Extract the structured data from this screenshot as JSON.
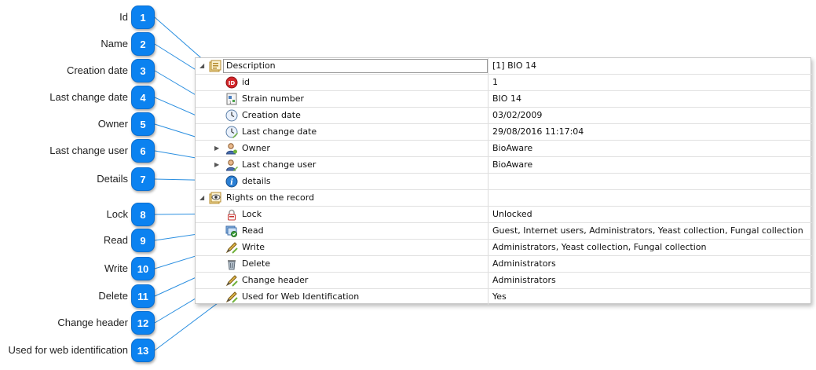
{
  "callouts": [
    {
      "num": "1",
      "label": "Id"
    },
    {
      "num": "2",
      "label": "Name"
    },
    {
      "num": "3",
      "label": "Creation date"
    },
    {
      "num": "4",
      "label": "Last change date"
    },
    {
      "num": "5",
      "label": "Owner"
    },
    {
      "num": "6",
      "label": "Last change user"
    },
    {
      "num": "7",
      "label": "Details"
    },
    {
      "num": "8",
      "label": "Lock"
    },
    {
      "num": "9",
      "label": "Read"
    },
    {
      "num": "10",
      "label": "Write"
    },
    {
      "num": "11",
      "label": "Delete"
    },
    {
      "num": "12",
      "label": "Change header"
    },
    {
      "num": "13",
      "label": "Used for web identification"
    }
  ],
  "groups": {
    "description": {
      "label": "Description",
      "value": "[1] BIO 14",
      "icon": "record-description-icon"
    },
    "rights": {
      "label": "Rights on the record",
      "value": "",
      "icon": "rights-eye-icon"
    }
  },
  "rows": [
    {
      "name": "id",
      "value": "1",
      "icon": "id-icon"
    },
    {
      "name": "Strain number",
      "value": "BIO 14",
      "icon": "strain-number-icon"
    },
    {
      "name": "Creation date",
      "value": "03/02/2009",
      "icon": "clock-icon"
    },
    {
      "name": "Last change date",
      "value": "29/08/2016 11:17:04",
      "icon": "clock-edit-icon"
    },
    {
      "name": "Owner",
      "value": "BioAware",
      "icon": "user-icon"
    },
    {
      "name": "Last change user",
      "value": "BioAware",
      "icon": "user-edit-icon"
    },
    {
      "name": "details",
      "value": "",
      "icon": "info-icon"
    },
    {
      "name": "Lock",
      "value": "Unlocked",
      "icon": "lock-icon"
    },
    {
      "name": "Read",
      "value": "Guest, Internet users, Administrators, Yeast collection, Fungal collection",
      "icon": "read-icon"
    },
    {
      "name": "Write",
      "value": "Administrators, Yeast collection, Fungal collection",
      "icon": "write-pen-icon"
    },
    {
      "name": "Delete",
      "value": "Administrators",
      "icon": "trash-icon"
    },
    {
      "name": "Change header",
      "value": "Administrators",
      "icon": "pen-icon"
    },
    {
      "name": "Used for Web Identification",
      "value": "Yes",
      "icon": "pen-icon"
    }
  ],
  "colors": {
    "badge": "#0b82f0",
    "connector": "#2b8fe0"
  }
}
